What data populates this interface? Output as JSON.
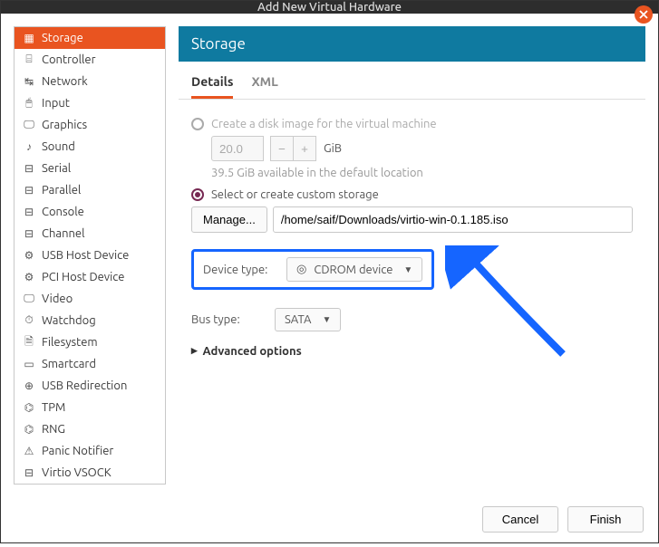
{
  "window": {
    "title": "Add New Virtual Hardware"
  },
  "sidebar": {
    "items": [
      {
        "label": "Storage"
      },
      {
        "label": "Controller"
      },
      {
        "label": "Network"
      },
      {
        "label": "Input"
      },
      {
        "label": "Graphics"
      },
      {
        "label": "Sound"
      },
      {
        "label": "Serial"
      },
      {
        "label": "Parallel"
      },
      {
        "label": "Console"
      },
      {
        "label": "Channel"
      },
      {
        "label": "USB Host Device"
      },
      {
        "label": "PCI Host Device"
      },
      {
        "label": "Video"
      },
      {
        "label": "Watchdog"
      },
      {
        "label": "Filesystem"
      },
      {
        "label": "Smartcard"
      },
      {
        "label": "USB Redirection"
      },
      {
        "label": "TPM"
      },
      {
        "label": "RNG"
      },
      {
        "label": "Panic Notifier"
      },
      {
        "label": "Virtio VSOCK"
      }
    ]
  },
  "main": {
    "title": "Storage",
    "tabs": {
      "details": "Details",
      "xml": "XML"
    },
    "radio_create": "Create a disk image for the virtual machine",
    "size_value": "20.0",
    "size_unit": "GiB",
    "available": "39.5 GiB available in the default location",
    "radio_custom": "Select or create custom storage",
    "manage": "Manage...",
    "path": "/home/saif/Downloads/virtio-win-0.1.185.iso",
    "device_type_label": "Device type:",
    "device_type_value": "CDROM device",
    "bus_type_label": "Bus type:",
    "bus_type_value": "SATA",
    "advanced": "Advanced options"
  },
  "footer": {
    "cancel": "Cancel",
    "finish": "Finish"
  }
}
